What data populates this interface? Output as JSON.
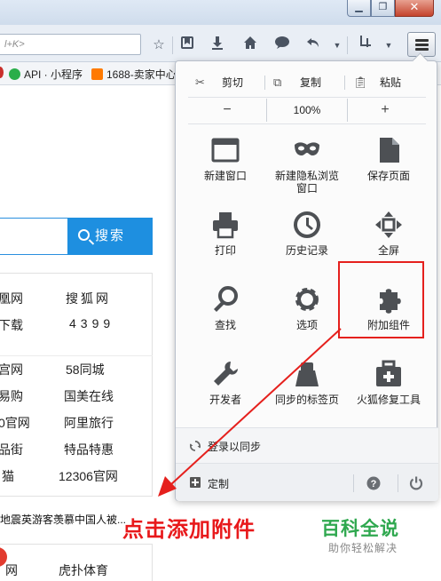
{
  "browser": {
    "url_placeholder": "l+K>",
    "bookmarks": [
      "API · 小程序",
      "1688-卖家中心"
    ]
  },
  "page": {
    "search_button": "搜索",
    "sites": [
      [
        "凰网",
        "搜狐网"
      ],
      [
        "下载",
        "4399"
      ],
      [
        "宫网",
        "58同城"
      ],
      [
        "易购",
        "国美在线"
      ],
      [
        "0官网",
        "阿里旅行"
      ],
      [
        "品街",
        "特品特惠"
      ],
      [
        "猫",
        "12306官网"
      ]
    ],
    "news": "地震英游客羡慕中国人被...",
    "bottom": [
      "网",
      "虎扑体育"
    ]
  },
  "menu": {
    "edit": {
      "cut": "剪切",
      "copy": "复制",
      "paste": "粘贴"
    },
    "zoom": {
      "minus": "−",
      "value": "100%",
      "plus": "+"
    },
    "items": [
      {
        "label": "新建窗口",
        "icon": "window-icon"
      },
      {
        "label": "新建隐私浏览\n窗口",
        "icon": "mask-icon"
      },
      {
        "label": "保存页面",
        "icon": "document-icon"
      },
      {
        "label": "打印",
        "icon": "printer-icon"
      },
      {
        "label": "历史记录",
        "icon": "clock-icon"
      },
      {
        "label": "全屏",
        "icon": "fullscreen-icon"
      },
      {
        "label": "查找",
        "icon": "magnifier-icon"
      },
      {
        "label": "选项",
        "icon": "gear-icon"
      },
      {
        "label": "附加组件",
        "icon": "puzzle-icon"
      },
      {
        "label": "开发者",
        "icon": "wrench-icon"
      },
      {
        "label": "同步的标签页",
        "icon": "synced-tabs-icon"
      },
      {
        "label": "火狐修复工具",
        "icon": "toolbox-icon"
      }
    ],
    "signin": "登录以同步",
    "customize": "定制"
  },
  "annotation": {
    "caption": "点击添加附件",
    "brand": "百科全说",
    "brand_sub": "助你轻松解决",
    "colors": {
      "highlight": "#e5201d",
      "brand": "#2fa84f"
    }
  }
}
